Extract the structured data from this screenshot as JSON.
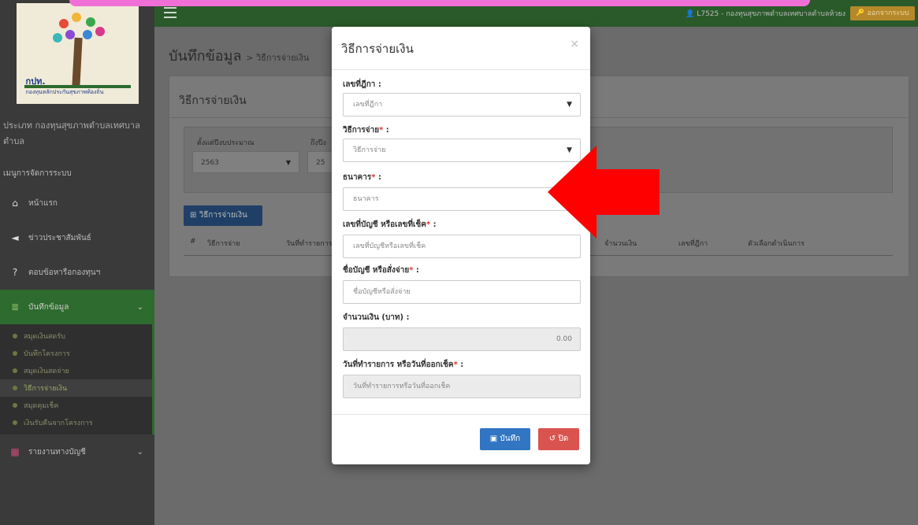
{
  "sidebar": {
    "logo_abbr": "กปท.",
    "logo_name": "กองทุนหลักประกันสุขภาพท้องถิ่น",
    "entity_name": "ประเภท กองทุนสุขภาพตำบลเทศบาลตำบล",
    "menu_head": "เมนูการจัดการระบบ",
    "items": [
      {
        "label": "หน้าแรก",
        "icon": "home-icon"
      },
      {
        "label": "ข่าวประชาสัมพันธ์",
        "icon": "megaphone-icon"
      },
      {
        "label": "ตอบข้อหารือกองทุนฯ",
        "icon": "question-icon"
      },
      {
        "label": "บันทึกข้อมูล",
        "icon": "database-icon"
      },
      {
        "label": "รายงานทางบัญชี",
        "icon": "table-icon"
      }
    ],
    "sub_items": [
      "สมุดเงินสดรับ",
      "บันทึกโครงการ",
      "สมุดเงินสดจ่าย",
      "วิธีการจ่ายเงิน",
      "สมุดคุมเช็ค",
      "เงินรับคืนจากโครงการ"
    ]
  },
  "topbar": {
    "user": "👤 L7525 - กองทุนสุขภาพตำบลเทศบาลตำบลห้วยง",
    "logout": "🔑 ออกจากระบบ"
  },
  "page": {
    "title": "บันทึกข้อมูล",
    "crumb": "> วิธีการจ่ายเงิน",
    "card_title": "วิธีการจ่ายเงิน",
    "filter_from_label": "ตั้งแต่ปีงบประมาณ",
    "filter_from_value": "2563",
    "filter_to_label": "ถึงปีง",
    "filter_to_value": "25",
    "add_button": "วิธีการจ่ายเงิน",
    "columns": [
      "#",
      "วิธีการจ่าย",
      "วันที่ทำรายการ",
      "จำนวนเงิน",
      "เลขที่ฎีกา",
      "ตัวเลือกดำเนินการ"
    ]
  },
  "modal": {
    "title": "วิธีการจ่ายเงิน",
    "close_x": "×",
    "fields": [
      {
        "label": "เลขที่ฎีกา",
        "required": false,
        "value": "เลขที่ฎีกา"
      },
      {
        "label": "วิธีการจ่าย",
        "required": true,
        "value": "วิธีการจ่าย"
      },
      {
        "label": "ธนาคาร",
        "required": true,
        "value": "ธนาคาร"
      },
      {
        "label": "เลขที่บัญชี หรือเลขที่เช็ค",
        "required": true,
        "value": "เลขที่บัญชีหรือเลขที่เช็ค"
      },
      {
        "label": "ชื่อบัญชี หรือสั่งจ่าย",
        "required": true,
        "value": "ชื่อบัญชีหรือสั่งจ่าย"
      },
      {
        "label": "จำนวนเงิน (บาท)",
        "required": false,
        "value": "0.00"
      },
      {
        "label": "วันที่ทำรายการ หรือวันที่ออกเช็ค",
        "required": true,
        "value": "วันที่ทำรายการหรือวันที่ออกเช็ค"
      }
    ],
    "save": "บันทึก",
    "close": "ปิด"
  },
  "colors": {
    "accent_green": "#2a5a2a",
    "primary_blue": "#3175c3",
    "danger_red": "#d9534f",
    "arrow_red": "#ff0000"
  }
}
